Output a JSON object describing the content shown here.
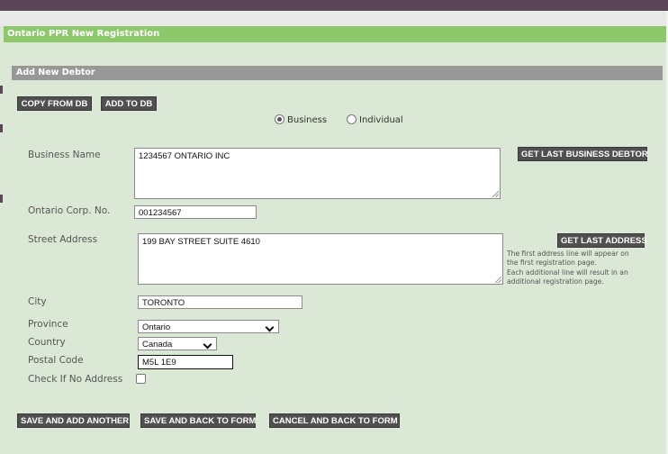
{
  "panel_title": "Ontario PPR New Registration",
  "section_title": "Add New Debtor",
  "top_buttons": {
    "copy_from_db": "COPY FROM DB",
    "add_to_db": "ADD TO DB"
  },
  "debtor_type": {
    "options": [
      "Business",
      "Individual"
    ],
    "selected": "Business"
  },
  "business_name": {
    "label": "Business Name",
    "value": "1234567 ONTARIO INC",
    "button": "GET LAST BUSINESS DEBTOR"
  },
  "corp_no": {
    "label": "Ontario Corp. No.",
    "value": "001234567"
  },
  "street_address": {
    "label": "Street Address",
    "value": "199 BAY STREET SUITE 4610",
    "button": "GET LAST ADDRESS",
    "note_lines": [
      "The first address line will appear on",
      "the first registration page.",
      "Each additional line will result in an",
      "additional registration page."
    ]
  },
  "city": {
    "label": "City",
    "value": "TORONTO"
  },
  "province": {
    "label": "Province",
    "value": "Ontario"
  },
  "country": {
    "label": "Country",
    "value": "Canada"
  },
  "postal_code": {
    "label": "Postal Code",
    "value": "M5L 1E9"
  },
  "no_address": {
    "label": "Check If No Address",
    "checked": false
  },
  "bottom_buttons": {
    "save_add_another": "SAVE AND ADD ANOTHER",
    "save_back": "SAVE AND BACK TO FORM",
    "cancel_back": "CANCEL AND BACK TO FORM"
  },
  "colors": {
    "panel_background": "#dbe8d5",
    "panel_header": "#8dc86a",
    "section_header": "#989898",
    "button": "#505050",
    "top_bar": "#5a4657"
  }
}
